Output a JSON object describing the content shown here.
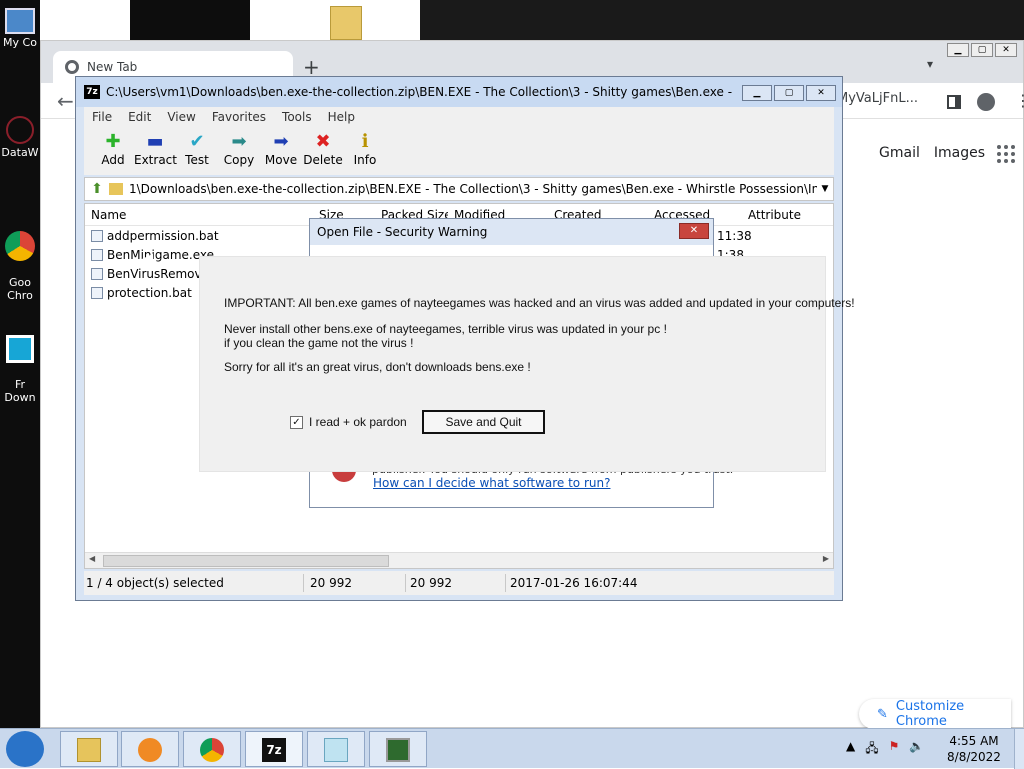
{
  "desktop": {
    "icons": [
      {
        "label": "My Co"
      },
      {
        "label": "DataW"
      },
      {
        "label": "Goo\nChro"
      },
      {
        "label": "Fr\nDown"
      }
    ]
  },
  "chrome": {
    "tab_title": "New Tab",
    "new_tab": "+",
    "profile_chip": "MyVaLjFnL...",
    "links": [
      "Gmail",
      "Images"
    ],
    "customize_label": "Customize Chrome"
  },
  "zip": {
    "title": "C:\\Users\\vm1\\Downloads\\ben.exe-the-collection.zip\\BEN.EXE - The Collection\\3 - Shitty games\\Ben.exe - Whirstle P...",
    "menu": [
      "File",
      "Edit",
      "View",
      "Favorites",
      "Tools",
      "Help"
    ],
    "tools": [
      {
        "label": "Add",
        "glyph": "✚",
        "color": "#2bb32b"
      },
      {
        "label": "Extract",
        "glyph": "▬",
        "color": "#1f3fb3"
      },
      {
        "label": "Test",
        "glyph": "✔",
        "color": "#2aa7c6"
      },
      {
        "label": "Copy",
        "glyph": "➡",
        "color": "#2a8a8a"
      },
      {
        "label": "Move",
        "glyph": "➡",
        "color": "#1f3fb3"
      },
      {
        "label": "Delete",
        "glyph": "✖",
        "color": "#d22"
      },
      {
        "label": "Info",
        "glyph": "ℹ",
        "color": "#b89200"
      }
    ],
    "address": "1\\Downloads\\ben.exe-the-collection.zip\\BEN.EXE - The Collection\\3 - Shitty games\\Ben.exe - Whirstle Possession\\In your mind\\",
    "columns": [
      "Name",
      "Size",
      "Packed Size",
      "Modified",
      "Created",
      "Accessed",
      "Attribute"
    ],
    "files": [
      {
        "name": "addpermission.bat",
        "time": "11:38"
      },
      {
        "name": "BenMinigame.exe",
        "time": "1:38"
      },
      {
        "name": "BenVirusRemover",
        "time": ""
      },
      {
        "name": "protection.bat",
        "time": ""
      }
    ],
    "status": {
      "selected": "1 / 4 object(s) selected",
      "size": "20 992",
      "packed": "20 992",
      "date": "2017-01-26 16:07:44"
    }
  },
  "security_warning": {
    "title": "Open File - Security Warning",
    "publisher_text": "publisher. You should only run software from publishers you trust.",
    "link": "How can I decide what software to run?"
  },
  "overlay": {
    "line1": "IMPORTANT: All ben.exe games of nayteegames was hacked and an virus was added and updated in your computers!",
    "line2": "Never install other bens.exe of nayteegames, terrible virus was updated in your pc !",
    "line3": "if you clean the game not the virus !",
    "line4": "Sorry for all it's an great virus, don't downloads bens.exe !",
    "checkbox_label": "I read + ok pardon",
    "checkbox_checked": "✓",
    "button_label": "Save and Quit"
  },
  "taskbar": {
    "time": "4:55 AM",
    "date": "8/8/2022"
  }
}
